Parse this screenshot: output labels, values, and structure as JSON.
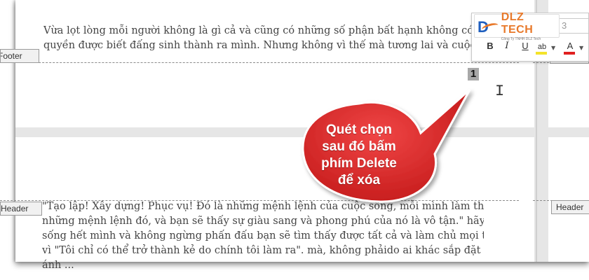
{
  "document": {
    "top_text": [
      "Vừa lọt lòng mỗi người không là gì cả và cũng có những số phận bất hạnh không có",
      "quyền được biết đấng sinh thành ra mình. Nhưng không vì thế mà tương lai và cuộc sống"
    ],
    "bottom_text": [
      "\"Tạo lập! Xây dựng! Phục vụ! Đó là những mệnh lệnh của cuộc sống, mỗi mình làm theo",
      "những mệnh lệnh đó, và bạn sẽ thấy sự giàu sang và phong phú của nó là vô tận.\" hãy",
      "sống hết mình và không ngừng phấn đấu bạn sẽ tìm thấy được tất cả và làm chủ mọi thứ",
      "vì \"Tôi chỉ có thể trở thành kẻ do chính tôi làm ra\". mà, không phảido ai khác sắp đặt hay",
      "ánh ..."
    ],
    "page_number": "1"
  },
  "tags": {
    "footer_left": "Footer",
    "header_left": "Header",
    "header_right": "Header",
    "footer_right": "Footer"
  },
  "toolbar": {
    "font_size": "3",
    "bold_label": "B",
    "italic_label": "I",
    "underline_label": "U",
    "highlight_label": "ab",
    "font_color_label": "A"
  },
  "logo": {
    "name": "DLZ TECH",
    "subtitle": "Công Ty TNHH DLZ Tech"
  },
  "callout": {
    "lines": [
      "Quét chọn",
      "sau đó bấm",
      "phím Delete",
      "để xóa"
    ],
    "color": "#e02a2a"
  }
}
